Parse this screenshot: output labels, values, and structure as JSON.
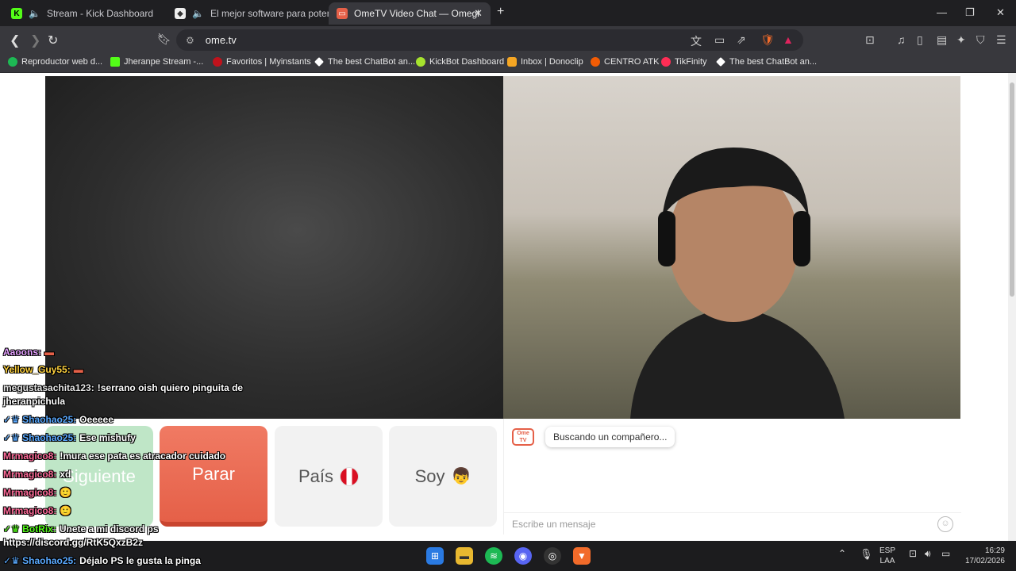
{
  "tabs": [
    {
      "label": "Stream - Kick Dashboard",
      "favicon": "kick-icon",
      "sound": true
    },
    {
      "label": "El mejor software para potenciar",
      "favicon": "streamer-bot-icon",
      "sound": true
    },
    {
      "label": "OmeTV Video Chat — Omegl",
      "favicon": "ometv-icon",
      "active": true
    }
  ],
  "address": {
    "url": "ome.tv"
  },
  "bookmarks": [
    {
      "label": "Reproductor web d...",
      "icon": "spotify-icon",
      "color": "#1db954"
    },
    {
      "label": "Jheranpe Stream -...",
      "icon": "kick-icon",
      "color": "#53fc18"
    },
    {
      "label": "Favoritos | Myinstants",
      "icon": "myinstants-icon",
      "color": "#c0121c"
    },
    {
      "label": "The best ChatBot an...",
      "icon": "botrix-icon",
      "color": "#ffffff"
    },
    {
      "label": "KickBot Dashboard",
      "icon": "kickbot-icon",
      "color": "#a6e22e"
    },
    {
      "label": "Inbox | Donoclip",
      "icon": "donoclip-icon",
      "color": "#f5a623"
    },
    {
      "label": "CENTRO ATK",
      "icon": "atk-icon",
      "color": "#f25c05"
    },
    {
      "label": "TikFinity",
      "icon": "tikfinity-icon",
      "color": "#ff2d55"
    },
    {
      "label": "The best ChatBot an...",
      "icon": "botrix-icon",
      "color": "#ffffff"
    }
  ],
  "controls": {
    "next_label": "Siguiente",
    "stop_label": "Parar",
    "country_label": "País",
    "gender_label": "Soy"
  },
  "chat": {
    "status": "Buscando un compañero...",
    "placeholder": "Escribe un mensaje"
  },
  "stream_chat": [
    {
      "user": "Aaoons:",
      "text": "",
      "color": "#e4a0ff"
    },
    {
      "user": "Yellow_Guy55:",
      "text": "",
      "color": "#ffd23f"
    },
    {
      "user": "megustasachita123:",
      "text": "!serrano oish quiero pinguita de",
      "color": "#e6e6e6"
    },
    {
      "user": "",
      "text": "jheranpichula",
      "color": "#e6e6e6"
    },
    {
      "user": "Shaohao25:",
      "text": "Oeeeee",
      "color": "#5aa9ff"
    },
    {
      "user": "Shaohao25:",
      "text": "Ese mishufy",
      "color": "#5aa9ff"
    },
    {
      "user": "Mrmagico8:",
      "text": "!mura ese pata es atracador cuidado",
      "color": "#ff6b9a"
    },
    {
      "user": "Mrmagico8:",
      "text": "xd",
      "color": "#ff6b9a"
    },
    {
      "user": "Mrmagico8:",
      "text": "",
      "color": "#ff6b9a"
    },
    {
      "user": "Mrmagico8:",
      "text": "",
      "color": "#ff6b9a"
    },
    {
      "user": "BotRix:",
      "text": "Unete a mi discord ps",
      "color": "#53fc18"
    },
    {
      "user": "",
      "text": "https://discord.gg/RtK5QxzB2z",
      "color": "#ffffff"
    },
    {
      "user": "Shaohao25:",
      "text": "Déjalo PS le gusta la pinga",
      "color": "#5aa9ff"
    }
  ],
  "clock": {
    "time": "16:29",
    "date": "17/02/2026",
    "lang": "ESP",
    "layout": "LAA"
  }
}
